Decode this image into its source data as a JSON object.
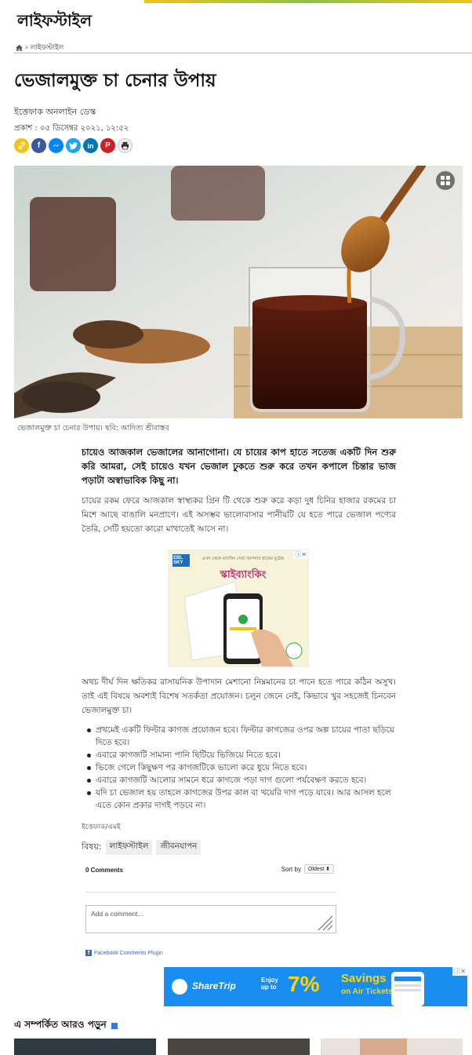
{
  "header": {
    "section_title": "লাইফস্টাইল",
    "breadcrumb_current": "লাইফস্টাইল",
    "breadcrumb_sep": "›"
  },
  "article": {
    "headline": "ভেজালমুক্ত চা চেনার উপায়",
    "author": "ইত্তেফাক অনলাইন ডেস্ক",
    "published": "প্রকাশ : ০৫ ডিসেম্বর ২০২১, ১২:৫২",
    "image_caption": "ভেজালমুক্ত চা চেনার উপায়। ছবি: আদিত্য শ্রীবাস্তব",
    "lead": "চায়েও আজকাল ভেজালের আনাগোনা। যে চায়ের কাপ হাতে সতেজ একটি দিন শুরু করি আমরা, সেই চায়েও যখন ভেজাল ঢুকতে শুরু করে তখন কপালে চিন্তার ভাজ পড়াটা অস্বাভাবিক কিছু না।",
    "paragraph_1": "চায়ের রকম ফেরে আজকাল স্বাস্থ্যকর গ্রিন টি থেকে শুরু করে কড়া দুধ চিনির হাজার রকমের চা মিশে আছে বাঙালি মনপ্রাণে। এই অসম্ভব ভালোবাসার পানীয়টি যে হতে পারে ভেজাল পণ্যের তৈরি, সেটি হয়তো কারো মাথাতেই আসে না।",
    "paragraph_2": "অথচ দীর্ঘ দিন ক্ষতিকর রাসায়নিক উপাদান মেশানো নিম্নমানের চা পানে হতে পারে কঠিন অসুখ। তাই এই বিষয়ে অবশ্যই বিশেষ সতর্কতা প্রয়োজন। চলুন জেনে নেই, কিভাবে খুব সহজেই চিনবেন ভেজালমুক্ত চা।",
    "bullets": [
      "প্রথমেই একটি ফিল্টার কাগজ প্রয়োজন হবে। ফিল্টার কাগজের ওপর অল্প চায়ের পাতা ছড়িয়ে দিতে হবে।",
      "এবারে কাগজটি সামান্য পানি ছিটিয়ে ভিজিয়ে নিতে হবে।",
      "ভিজে গেলে কিছুক্ষণ পর কাগজটিকে ভালো করে ধুয়ে নিতে হবে।",
      "এবারে কাগজটি আলোর সামনে ধরে কাগজে পড়া দাগ গুলো পর্যবেক্ষণ করতে হবে।",
      "যদি চা ভেজাল হয় তাহলে কাগজের উপর কাল বা খয়েরি দাগ পড়ে যাবে। আর আসল হলে এতে কোন প্রকার দাগই পড়বে না।"
    ],
    "signature": "ইত্তেফাক/এমই",
    "topics_label": "বিষয়:",
    "topics": [
      "লাইফস্টাইল",
      "জীবনযাপন"
    ]
  },
  "ads": {
    "middle_brand": "EBL SKY",
    "middle_headline": "স্কাইব্যাংকিং",
    "middle_tagline": "এখন থেকে ব্যাংকিং সেবা আপনার হাতের মুঠোয়",
    "bottom_brand": "ShareTrip",
    "bottom_prefix": "Enjoy up to",
    "bottom_percent": "7%",
    "bottom_line1": "Savings",
    "bottom_line2": "on Air Tickets"
  },
  "comments": {
    "count": "0 Comments",
    "sort_label": "Sort by",
    "sort_value": "Oldest",
    "placeholder": "Add a comment...",
    "plugin_label": "Facebook Comments Plugin"
  },
  "related": {
    "title": "এ সম্পর্কিত আরও পড়ুন"
  },
  "colors": {
    "accent_blue": "#2b7de9",
    "facebook": "#3b5998",
    "messenger": "#0084ff",
    "twitter": "#1da1f2",
    "linkedin": "#0077b5",
    "pinterest": "#cb2027",
    "copy_link": "#f0c419"
  },
  "share_icons": [
    "copy-link-icon",
    "facebook-icon",
    "messenger-icon",
    "twitter-icon",
    "linkedin-icon",
    "pinterest-icon",
    "print-icon"
  ]
}
